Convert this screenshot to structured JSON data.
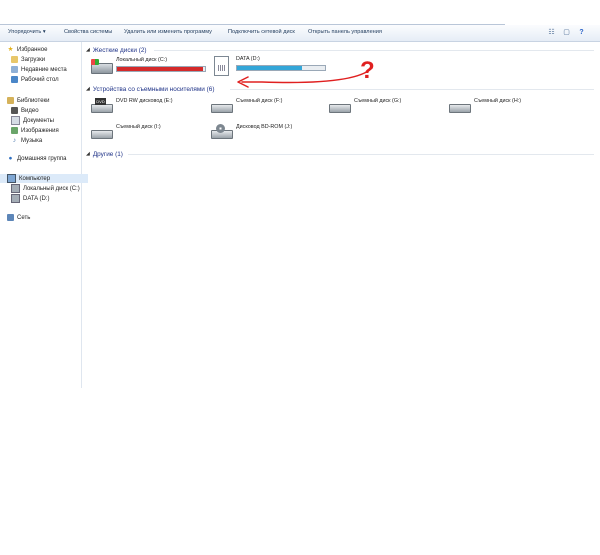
{
  "toolbar": {
    "items": [
      "Упорядочить ▾",
      "Свойства системы",
      "Удалить или изменить программу",
      "Подключить сетевой диск",
      "Открыть панель управления"
    ]
  },
  "nav": {
    "favorites": "Избранное",
    "downloads": "Загрузки",
    "recent": "Недавние места",
    "desktop": "Рабочий стол",
    "libraries": "Библиотеки",
    "video": "Видео",
    "documents": "Документы",
    "images": "Изображения",
    "music": "Музыка",
    "homegroup": "Домашняя группа",
    "computer": "Компьютер",
    "local_c": "Локальный диск (C:)",
    "data_d": "DATA (D:)",
    "network": "Сеть"
  },
  "groups": {
    "hard_disks": "Жесткие диски (2)",
    "removable": "Устройства со съемными носителями (6)",
    "other": "Другие (1)"
  },
  "hard_disks": [
    {
      "name": "Локальный диск (C:)",
      "fill": 0.98,
      "color": "#d42a2a"
    },
    {
      "name": "DATA (D:)",
      "fill": 0.74,
      "color": "#33a6d8"
    }
  ],
  "removable": [
    {
      "name": "DVD RW дисковод (E:)",
      "icon": "dvd-drive-icon"
    },
    {
      "name": "Съемный диск (F:)",
      "icon": "removable-disk-icon"
    },
    {
      "name": "Съемный диск (G:)",
      "icon": "removable-disk-icon"
    },
    {
      "name": "Съемный диск (H:)",
      "icon": "removable-disk-icon"
    },
    {
      "name": "Съемный диск (I:)",
      "icon": "removable-disk-icon"
    },
    {
      "name": "Дисковод BD-ROM (J:)",
      "icon": "bd-rom-drive-icon"
    }
  ],
  "annotation": {
    "mark": "?",
    "color": "#e02020"
  }
}
